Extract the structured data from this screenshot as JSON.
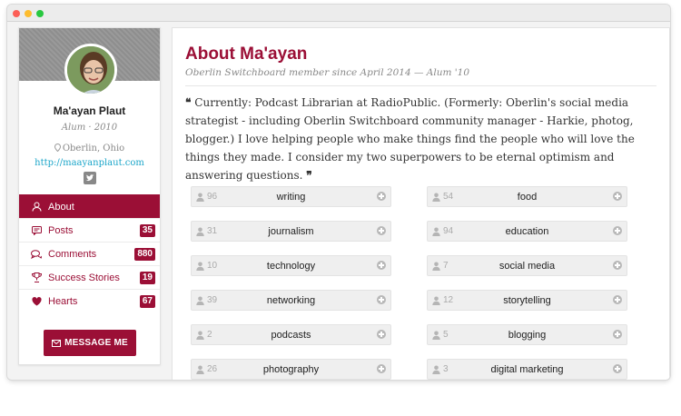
{
  "window": {
    "controls": [
      "close",
      "minimize",
      "zoom"
    ]
  },
  "profile": {
    "name": "Ma'ayan Plaut",
    "role": "Alum · 2010",
    "location": "Oberlin, Ohio",
    "website": "http://maayanplaut.com",
    "social_icon": "twitter-icon"
  },
  "nav": [
    {
      "label": "About",
      "icon": "user-icon",
      "badge": null,
      "active": true
    },
    {
      "label": "Posts",
      "icon": "comment-icon",
      "badge": "35",
      "active": false
    },
    {
      "label": "Comments",
      "icon": "comments-icon",
      "badge": "880",
      "active": false
    },
    {
      "label": "Success Stories",
      "icon": "trophy-icon",
      "badge": "19",
      "active": false
    },
    {
      "label": "Hearts",
      "icon": "heart-icon",
      "badge": "67",
      "active": false
    }
  ],
  "message_button": "MESSAGE ME",
  "main": {
    "title": "About Ma'ayan",
    "subtitle": "Oberlin Switchboard member since April 2014 — Alum '10",
    "bio": "Currently: Podcast Librarian at RadioPublic. (Formerly: Oberlin's social media strategist - including Oberlin Switchboard community manager - Harkie, photog, blogger.) I love helping people who make things find the people who will love the things they made. I consider my two superpowers to be eternal optimism and answering questions."
  },
  "tags_left": [
    {
      "count": "96",
      "label": "writing"
    },
    {
      "count": "31",
      "label": "journalism"
    },
    {
      "count": "10",
      "label": "technology"
    },
    {
      "count": "39",
      "label": "networking"
    },
    {
      "count": "2",
      "label": "podcasts"
    },
    {
      "count": "26",
      "label": "photography"
    }
  ],
  "tags_right": [
    {
      "count": "54",
      "label": "food"
    },
    {
      "count": "94",
      "label": "education"
    },
    {
      "count": "7",
      "label": "social media"
    },
    {
      "count": "12",
      "label": "storytelling"
    },
    {
      "count": "5",
      "label": "blogging"
    },
    {
      "count": "3",
      "label": "digital marketing"
    }
  ],
  "colors": {
    "accent": "#9b0f36",
    "link": "#1aa5c9"
  }
}
